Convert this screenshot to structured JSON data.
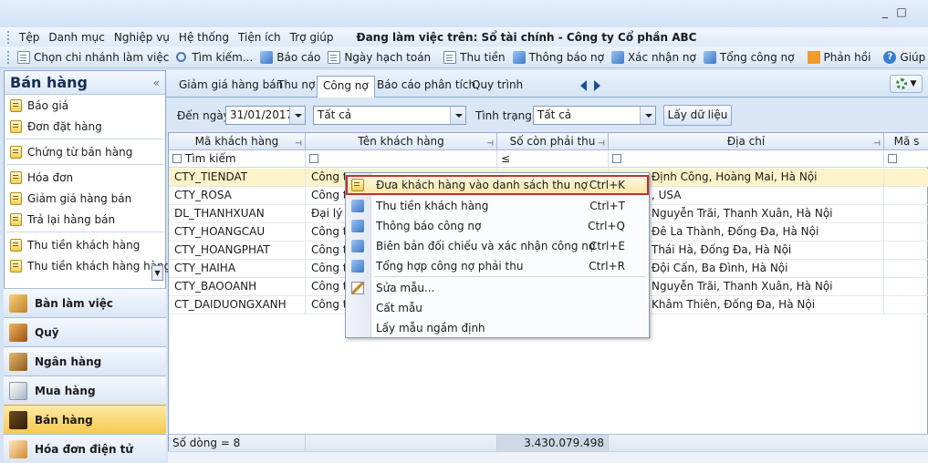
{
  "window": {
    "minimize": "_",
    "maximize": "□"
  },
  "menubar": {
    "items": [
      "Tệp",
      "Danh mục",
      "Nghiệp vụ",
      "Hệ thống",
      "Tiện ích",
      "Trợ giúp"
    ],
    "working": "Đang làm việc trên: Sổ tài chính - Công ty Cổ phần ABC"
  },
  "toolbar": {
    "choose_branch": "Chọn chi nhánh làm việc",
    "search": "Tìm kiếm...",
    "report": "Báo cáo",
    "posting_date": "Ngày hạch toán",
    "collect": "Thu tiền",
    "debt_notice": "Thông báo nợ",
    "confirm_debt": "Xác nhận nợ",
    "total_debt": "Tổng công nợ",
    "feedback": "Phản hồi",
    "help": "Giúp"
  },
  "left_panel": {
    "title": "Bán hàng",
    "collapse": "«",
    "items": [
      "Báo giá",
      "Đơn đặt hàng",
      "Chứng từ bán hàng",
      "Hóa đơn",
      "Giảm giá hàng bán",
      "Trả lại hàng bán",
      "Thu tiền khách hàng",
      "Thu tiền khách hàng hàng"
    ],
    "scroll": "▼"
  },
  "nav_groups": [
    "Bàn làm việc",
    "Quỹ",
    "Ngân hàng",
    "Mua hàng",
    "Bán hàng",
    "Hóa đơn điện tử"
  ],
  "tabs": [
    "Giảm giá hàng bán",
    "Thu nợ",
    "Công nợ",
    "Báo cáo phân tích",
    "Quy trình"
  ],
  "filter": {
    "date_label": "Đến ngày",
    "date_value": "31/01/2017",
    "scope_value": "Tất cả",
    "status_label": "Tình trạng",
    "status_value": "Tất cả",
    "load_button": "Lấy dữ liệu"
  },
  "grid": {
    "columns": [
      "Mã khách hàng",
      "Tên khách hàng",
      "Số còn phải thu",
      "Địa chỉ",
      "Mã s"
    ],
    "filter_row": {
      "search": "Tìm kiếm",
      "op": "≤"
    },
    "rows": [
      {
        "code": "CTY_TIENDAT",
        "name": "Công ty",
        "address": "Định Công, Hoàng Mai, Hà Nội"
      },
      {
        "code": "CTY_ROSA",
        "name": "Công ty",
        "address": ", USA"
      },
      {
        "code": "DL_THANHXUAN",
        "name": "Đại lý T",
        "address": "Nguyễn Trãi, Thanh Xuân, Hà Nội"
      },
      {
        "code": "CTY_HOANGCAU",
        "name": "Công ty",
        "address": "Đê La Thành, Đống Đa, Hà Nội"
      },
      {
        "code": "CTY_HOANGPHAT",
        "name": "Công ty",
        "address": "Thái Hà, Đống Đa, Hà Nội"
      },
      {
        "code": "CTY_HAIHA",
        "name": "Công ty",
        "address": "Đội Cấn, Ba Đình, Hà Nội"
      },
      {
        "code": "CTY_BAOOANH",
        "name": "Công ty",
        "address": "Nguyễn Trãi, Thanh Xuân, Hà Nội"
      },
      {
        "code": "CT_DAIDUONGXANH",
        "name": "Công ty",
        "address": "Khâm Thiên, Đống Đa, Hà Nội"
      }
    ],
    "footer": {
      "row_count": "Số dòng = 8",
      "total": "3.430.079.498"
    }
  },
  "context_menu": {
    "items": [
      {
        "label": "Đưa khách hàng vào danh sách thu nợ",
        "shortcut": "Ctrl+K"
      },
      {
        "label": "Thu tiền khách hàng",
        "shortcut": "Ctrl+T"
      },
      {
        "label": "Thông báo công nợ",
        "shortcut": "Ctrl+Q"
      },
      {
        "label": "Biên bản đối chiếu và xác nhận công nợ",
        "shortcut": "Ctrl+E"
      },
      {
        "label": "Tổng hợp công nợ phải thu",
        "shortcut": "Ctrl+R"
      },
      {
        "label": "Sửa mẫu...",
        "shortcut": ""
      },
      {
        "label": "Cất mẫu",
        "shortcut": ""
      },
      {
        "label": "Lấy mẫu ngầm định",
        "shortcut": ""
      }
    ]
  },
  "colors": {
    "accent": "#c0312e",
    "selected_row": "#fdf3c9",
    "active_nav": "#f7c94f"
  }
}
